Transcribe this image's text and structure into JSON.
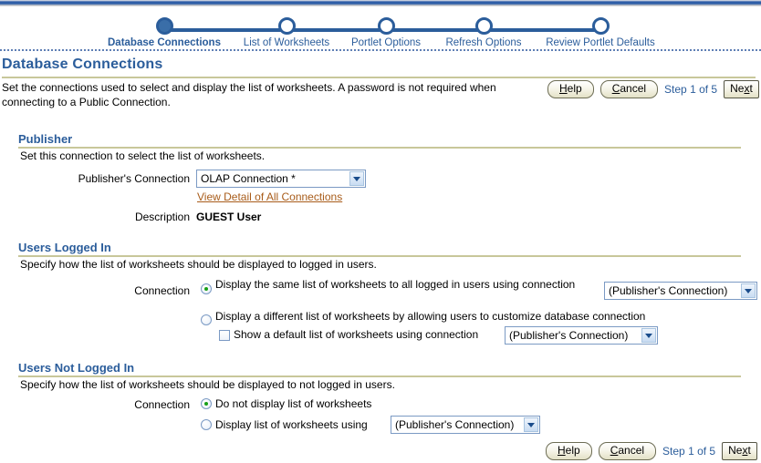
{
  "wizard": {
    "steps": [
      {
        "label": "Database Connections",
        "active": true
      },
      {
        "label": "List of Worksheets",
        "active": false
      },
      {
        "label": "Portlet Options",
        "active": false
      },
      {
        "label": "Refresh Options",
        "active": false
      },
      {
        "label": "Review Portlet Defaults",
        "active": false
      }
    ]
  },
  "page": {
    "title": "Database Connections",
    "intro": "Set the connections used to select and display the list of worksheets. A password is not required when connecting to a Public Connection."
  },
  "actions": {
    "help_label": "Help",
    "help_accesskey": "H",
    "cancel_label": "Cancel",
    "cancel_accesskey": "C",
    "next_label": "Next",
    "next_accesskey": "x",
    "step_text": "Step 1 of 5"
  },
  "publisher": {
    "heading": "Publisher",
    "subtext": "Set this connection to select the list of worksheets.",
    "connection_label": "Publisher's Connection",
    "connection_value": "OLAP Connection *",
    "view_detail_link": "View Detail of All Connections",
    "description_label": "Description",
    "description_value": "GUEST User"
  },
  "users_logged_in": {
    "heading": "Users Logged In",
    "subtext": "Specify how the list of worksheets should be displayed to logged in users.",
    "connection_label": "Connection",
    "option_same_label": "Display the same list of worksheets to all logged in users using connection",
    "option_same_selected": true,
    "option_same_connection": "(Publisher's Connection)",
    "option_different_label": "Display a different list of worksheets by allowing users to customize database connection",
    "option_different_selected": false,
    "default_checkbox_label": "Show a default list of worksheets using connection",
    "default_checkbox_checked": false,
    "default_connection": "(Publisher's Connection)"
  },
  "users_not_logged_in": {
    "heading": "Users Not Logged In",
    "subtext": "Specify how the list of worksheets should be displayed to not logged in users.",
    "connection_label": "Connection",
    "option_none_label": "Do not display list of worksheets",
    "option_none_selected": true,
    "option_display_label": "Display list of worksheets using",
    "option_display_selected": false,
    "option_display_connection": "(Publisher's Connection)"
  },
  "colors": {
    "brand_blue": "#2b5d9b",
    "rule_khaki": "#c8c79a",
    "link_orange": "#a85c1a",
    "radio_green": "#17a017"
  }
}
